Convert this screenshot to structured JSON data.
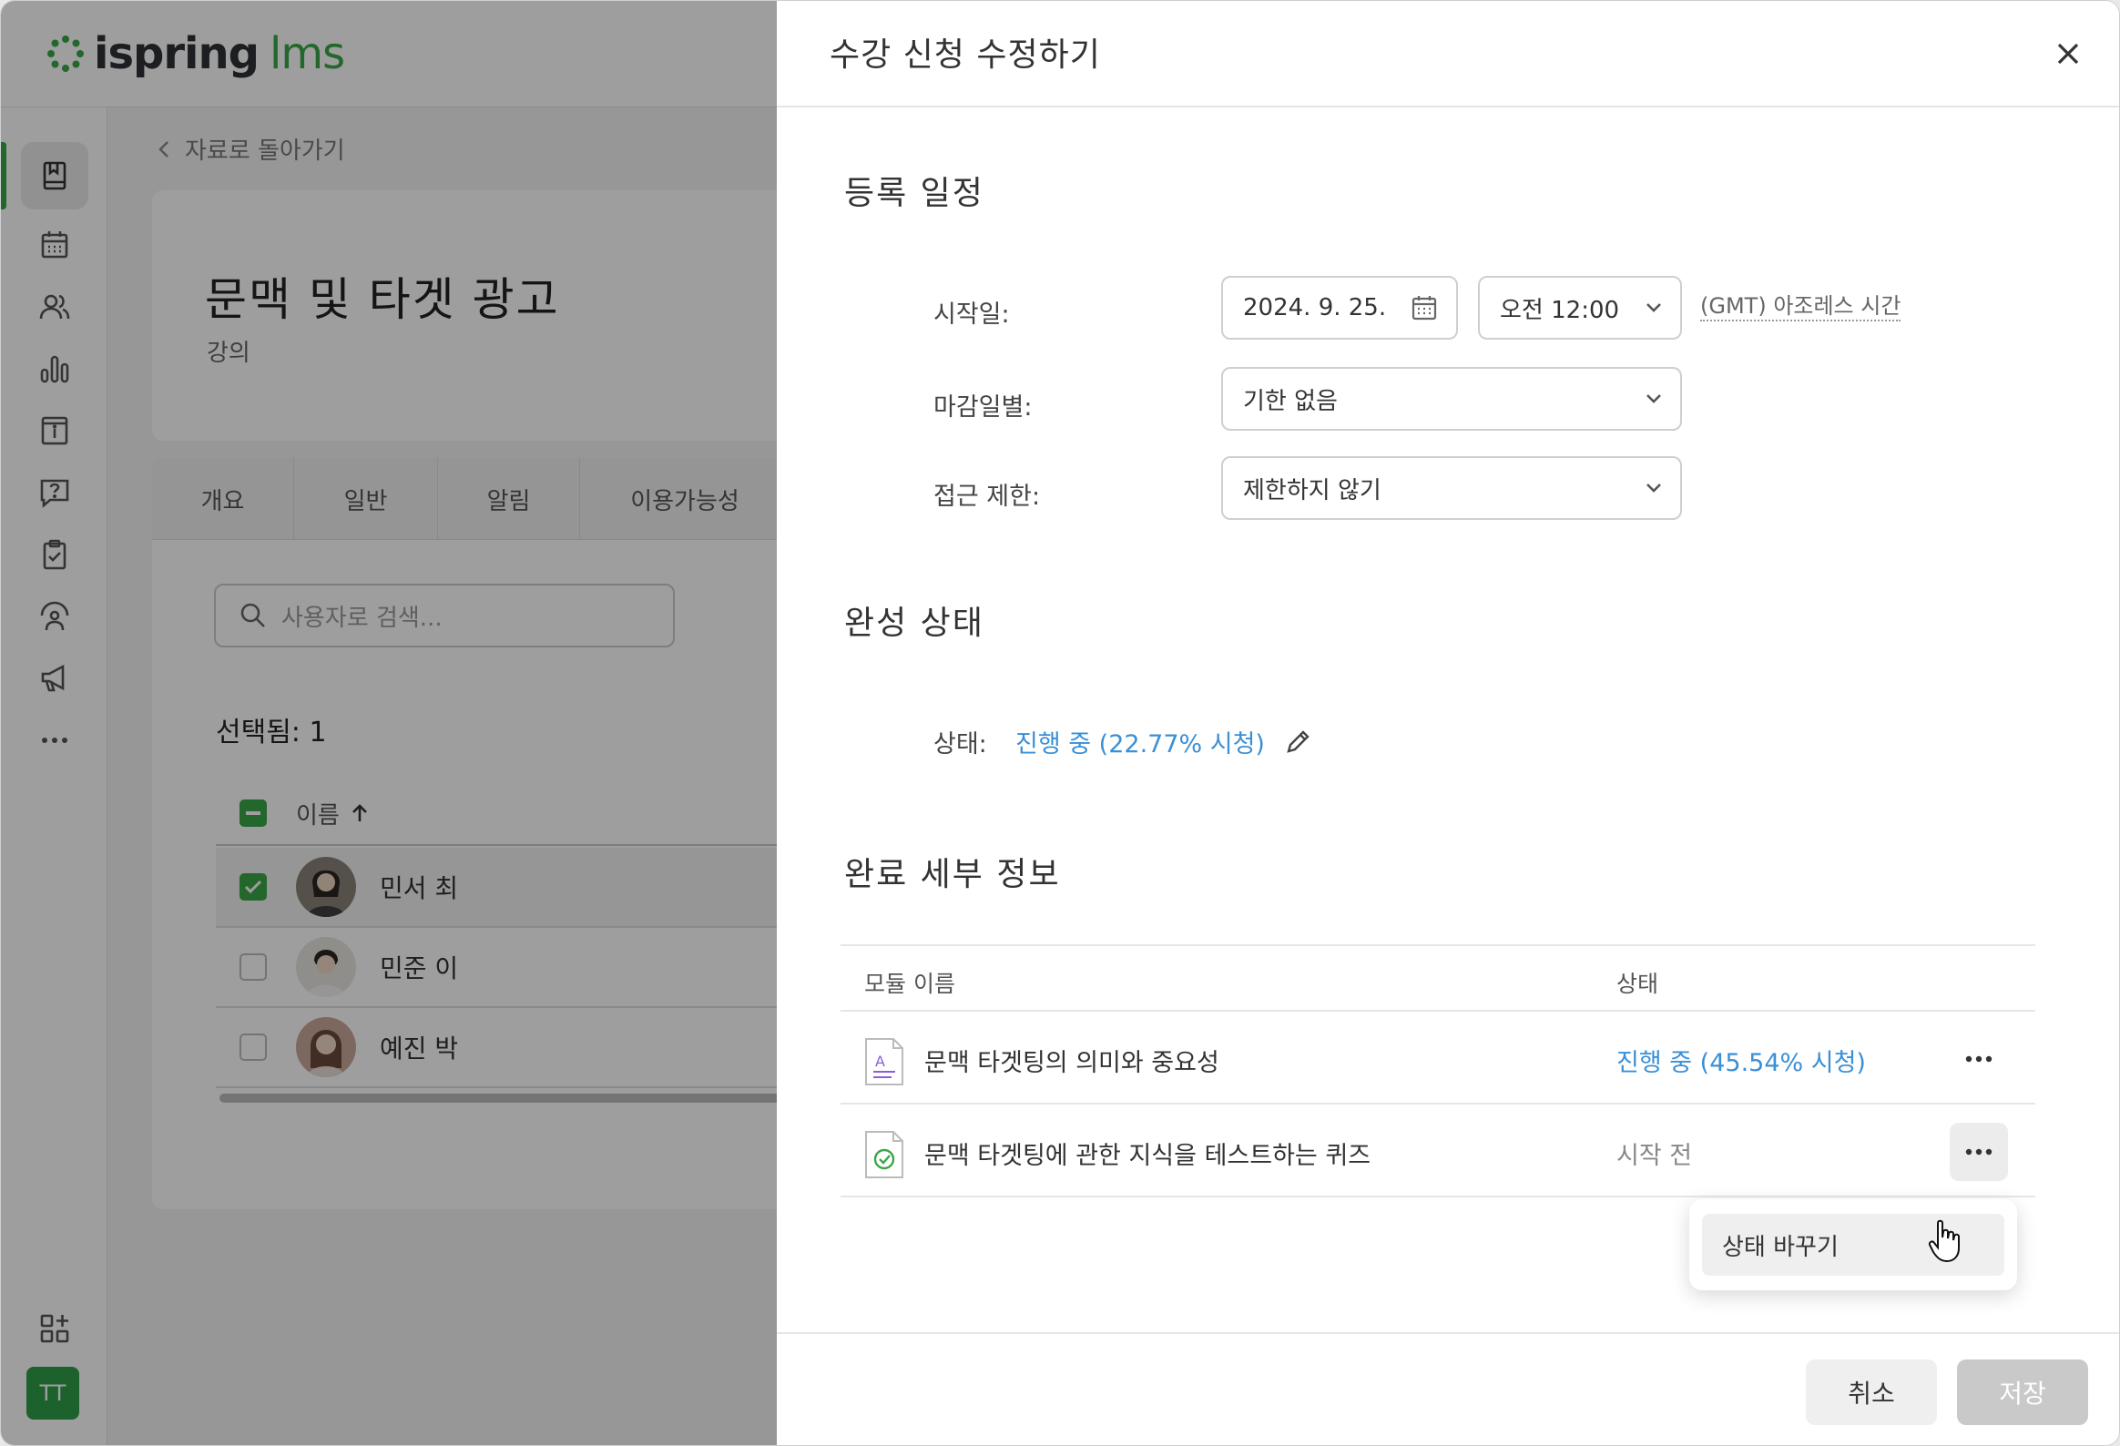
{
  "app": {
    "logo_brand": "ispring",
    "logo_product": "lms",
    "brand_color": "#3aa648",
    "user_initials": "TT"
  },
  "sidebar": {
    "items": [
      {
        "icon": "home-icon"
      },
      {
        "icon": "book-icon",
        "active": true
      },
      {
        "icon": "calendar-icon"
      },
      {
        "icon": "users-icon"
      },
      {
        "icon": "reports-icon"
      },
      {
        "icon": "info-board-icon"
      },
      {
        "icon": "question-icon"
      },
      {
        "icon": "clipboard-check-icon"
      },
      {
        "icon": "gamification-icon"
      },
      {
        "icon": "megaphone-icon"
      },
      {
        "icon": "more-icon"
      },
      {
        "icon": "apps-add-icon"
      }
    ]
  },
  "background": {
    "back_link": "자료로 돌아가기",
    "course_title": "문맥 및 타겟 광고",
    "course_type": "강의",
    "tabs": [
      "개요",
      "일반",
      "알림",
      "이용가능성"
    ],
    "search_placeholder": "사용자로 검색...",
    "selected_label": "선택됨: 1",
    "name_header": "이름",
    "users": [
      {
        "name": "민서 최",
        "checked": true
      },
      {
        "name": "민준 이",
        "checked": false
      },
      {
        "name": "예진 박",
        "checked": false
      }
    ]
  },
  "panel": {
    "title": "수강 신청 수정하기",
    "schedule": {
      "section_title": "등록 일정",
      "start_label": "시작일:",
      "start_date": "2024. 9. 25.",
      "start_time": "오전 12:00",
      "timezone": "(GMT) 아조레스 시간",
      "due_label": "마감일별:",
      "due_value": "기한 없음",
      "access_label": "접근 제한:",
      "access_value": "제한하지 않기"
    },
    "completion": {
      "section_title": "완성 상태",
      "status_label": "상태:",
      "status_value": "진행 중 (22.77% 시청)"
    },
    "details": {
      "section_title": "완료 세부 정보",
      "col_module": "모듈 이름",
      "col_status": "상태",
      "rows": [
        {
          "name": "문맥 타겟팅의 의미와 중요성",
          "status": "진행 중 (45.54% 시청)",
          "icon": "document-icon"
        },
        {
          "name": "문맥 타겟팅에 관한 지식을 테스트하는 퀴즈",
          "status": "시작 전",
          "icon": "quiz-icon"
        }
      ],
      "menu_item": "상태 바꾸기"
    },
    "footer": {
      "cancel_label": "취소",
      "save_label": "저장"
    }
  },
  "colors": {
    "link_blue": "#3a8fd6",
    "overlay": "rgba(0,0,0,0.38)"
  }
}
